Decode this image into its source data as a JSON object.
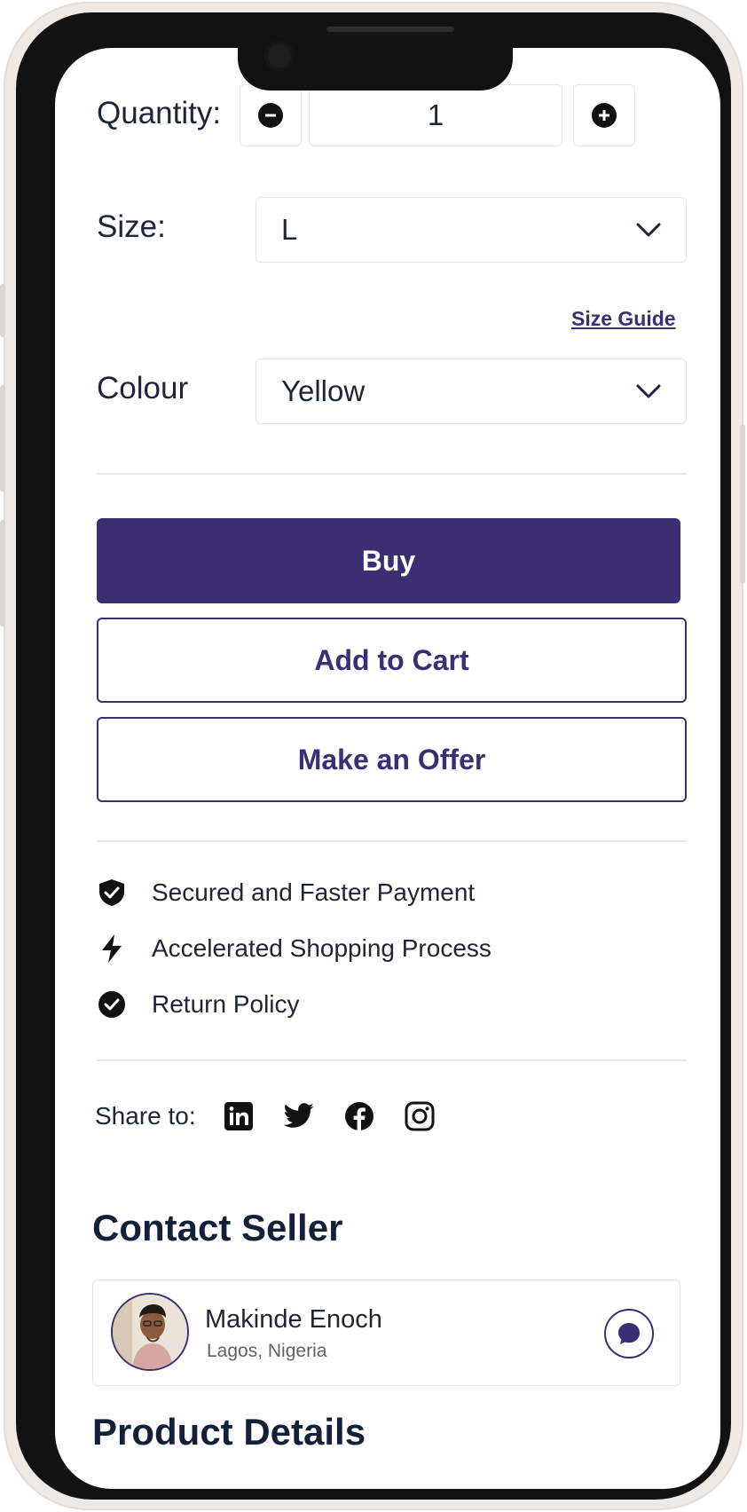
{
  "quantity": {
    "label": "Quantity:",
    "value": "1"
  },
  "size": {
    "label": "Size:",
    "value": "L",
    "guide": "Size Guide"
  },
  "colour": {
    "label": "Colour",
    "value": "Yellow"
  },
  "actions": {
    "buy": "Buy",
    "add_to_cart": "Add to Cart",
    "make_offer": "Make an Offer"
  },
  "features": [
    {
      "label": "Secured and Faster Payment",
      "icon": "shield-check-icon"
    },
    {
      "label": "Accelerated Shopping Process",
      "icon": "lightning-icon"
    },
    {
      "label": "Return Policy",
      "icon": "check-circle-icon"
    }
  ],
  "share": {
    "label": "Share to:",
    "icons": [
      "linkedin-icon",
      "twitter-icon",
      "facebook-icon",
      "instagram-icon"
    ]
  },
  "seller": {
    "section_title": "Contact Seller",
    "name": "Makinde Enoch",
    "location": "Lagos, Nigeria",
    "chat_icon": "chat-bubble-icon"
  },
  "product": {
    "section_title": "Product Details"
  },
  "colors": {
    "accent": "#3b2e73",
    "text": "#1d2536"
  }
}
